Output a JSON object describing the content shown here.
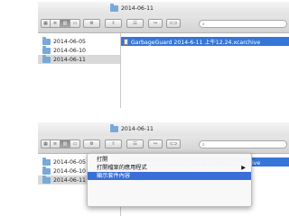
{
  "window_title": "2014-06-11",
  "toolbar": {
    "view_icons": [
      "icon-view-icon",
      "list-view-icon",
      "column-view-icon",
      "coverflow-view-icon"
    ],
    "arrange_label": "☷",
    "action_label": "⚙",
    "share_label": "⇪",
    "tags_label": "⊂⊃",
    "search_placeholder": ""
  },
  "sidebar": {
    "items": [
      {
        "label": "2014-06-05",
        "selected": false
      },
      {
        "label": "2014-06-10",
        "selected": false
      },
      {
        "label": "2014-06-11",
        "selected": true
      }
    ]
  },
  "main": {
    "file": {
      "label": "GarbageGuard 2014-6-11 上午12.24.xcarchive",
      "selected": true
    }
  },
  "context_menu": {
    "items": [
      {
        "label": "打開",
        "highlighted": false,
        "submenu": false
      },
      {
        "label": "打開檔案的應用程式",
        "highlighted": false,
        "submenu": true
      },
      {
        "label": "顯示套件內容",
        "highlighted": true,
        "submenu": false
      }
    ],
    "submenu_arrow": "▶"
  },
  "colors": {
    "selection_blue": "#3576d6",
    "menu_highlight": "#3a6ed8",
    "folder_blue": "#78a9d8"
  }
}
